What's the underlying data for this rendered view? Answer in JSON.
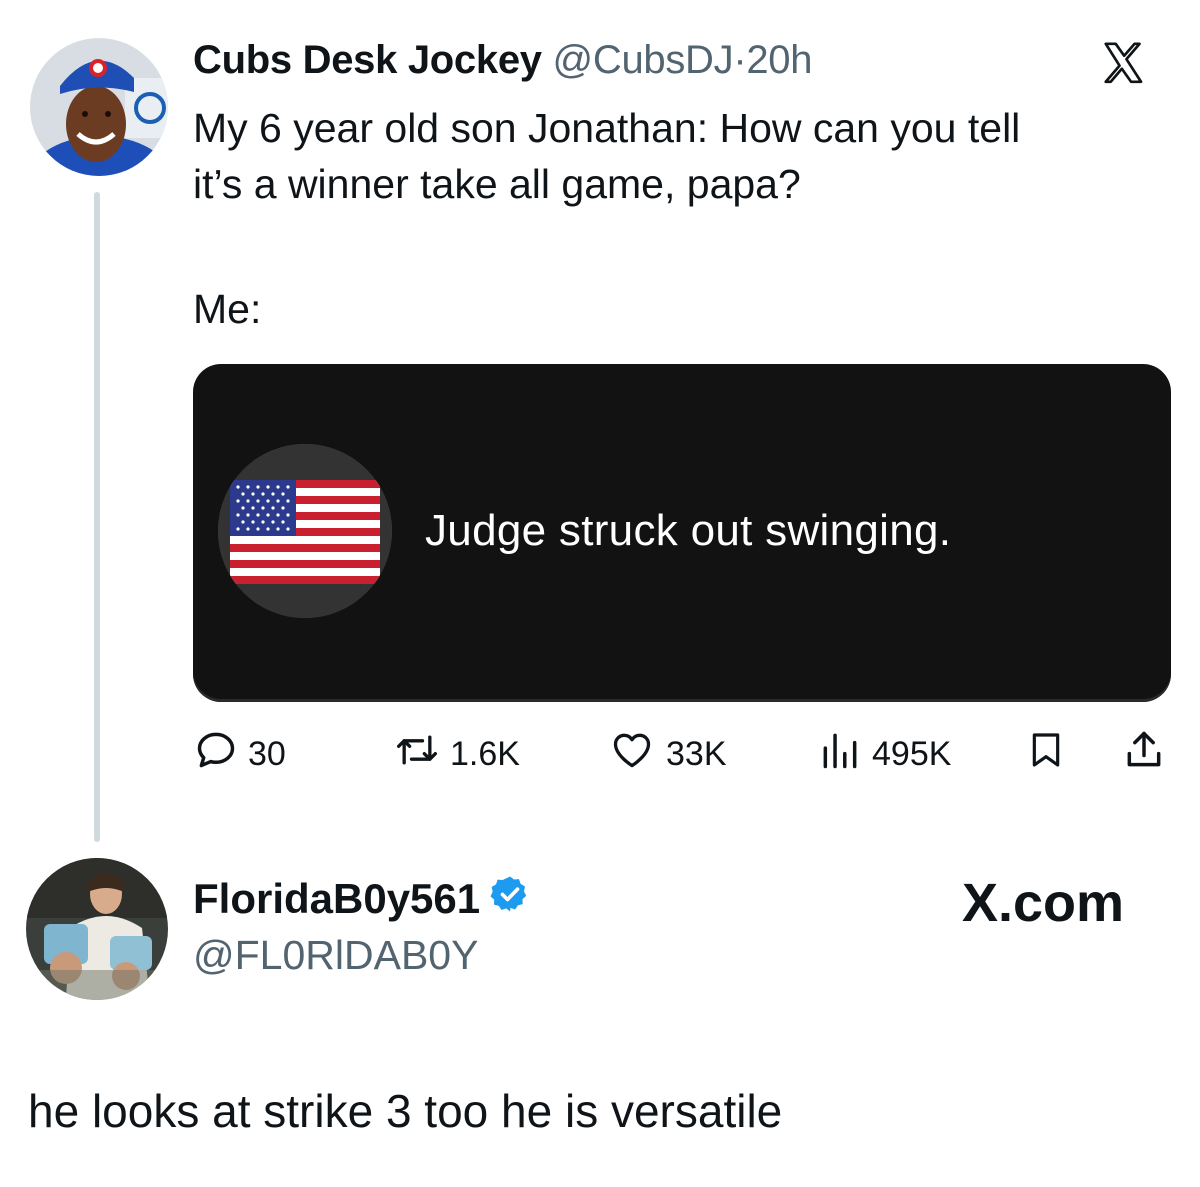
{
  "quoted_post": {
    "display_name": "Cubs Desk Jockey",
    "handle": "@CubsDJ",
    "separator": "·",
    "time": "20h",
    "text_lines": [
      "My 6 year old son Jonathan: How can you tell",
      "it’s a winner take all game, papa?"
    ],
    "me_label": "Me:",
    "card": {
      "text": "Judge struck out swinging.",
      "icon": "us-flag-icon"
    },
    "actions": {
      "replies": "30",
      "reposts": "1.6K",
      "likes": "33K",
      "views": "495K"
    },
    "platform_icon": "x-logo-icon"
  },
  "reply": {
    "display_name": "FloridaB0y561",
    "verified": true,
    "handle": "@FL0RlDAB0Y",
    "platform": "X.com",
    "text": "he looks at strike 3 too he is versatile"
  },
  "colors": {
    "text": "#0f1419",
    "secondary": "#536471",
    "verified": "#1d9bf0",
    "card_bg": "#121212"
  }
}
